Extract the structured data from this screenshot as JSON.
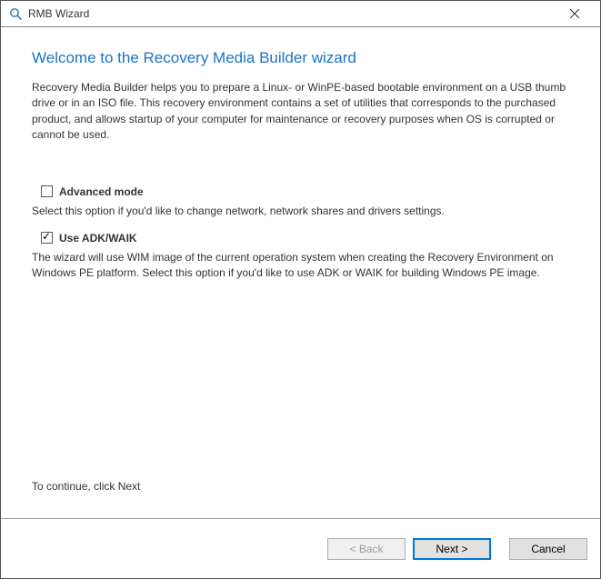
{
  "window": {
    "title": "RMB Wizard"
  },
  "heading": "Welcome to the Recovery Media Builder wizard",
  "intro": "Recovery Media Builder helps you to prepare a Linux- or WinPE-based bootable environment on a USB thumb drive or in an ISO file. This recovery environment contains a set of utilities that corresponds to the purchased product, and allows startup of your computer for maintenance or recovery purposes when OS is corrupted or cannot be used.",
  "options": {
    "advanced": {
      "label": "Advanced mode",
      "checked": false,
      "description": "Select this option if you'd like to change network, network shares and drivers settings."
    },
    "adk": {
      "label": "Use ADK/WAIK",
      "checked": true,
      "description": "The wizard will use WIM image of the current operation system when creating the Recovery Environment on Windows PE platform. Select this option if you'd like to use ADK or WAIK for building Windows PE image."
    }
  },
  "continue_text": "To continue, click Next",
  "buttons": {
    "back": "< Back",
    "next": "Next >",
    "cancel": "Cancel"
  }
}
